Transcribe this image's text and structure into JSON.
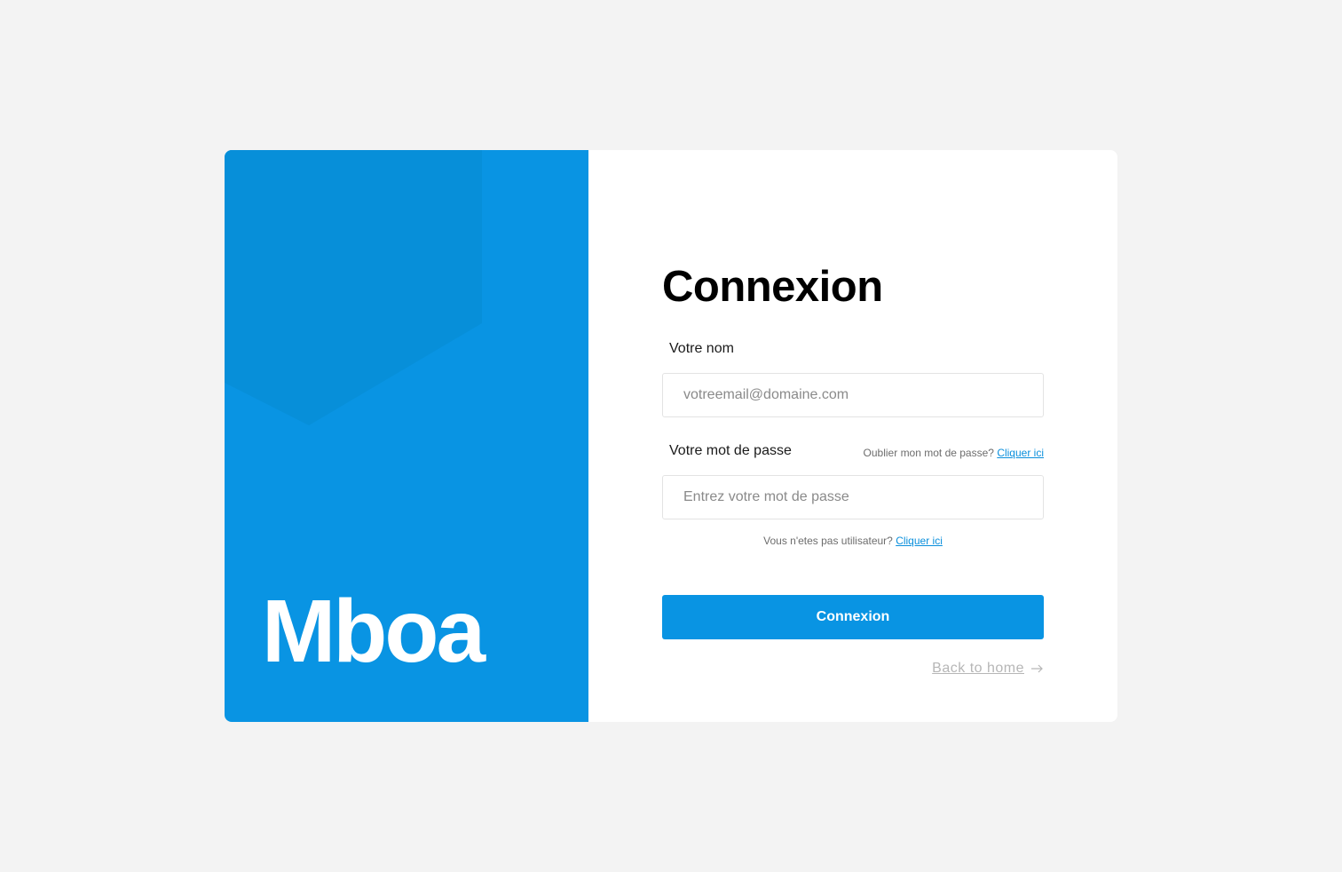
{
  "brand": {
    "name": "Mboa",
    "color": "#0994e3"
  },
  "login": {
    "title": "Connexion",
    "name_label": "Votre nom",
    "name_placeholder": "votreemail@domaine.com",
    "password_label": "Votre mot de passe",
    "password_placeholder": "Entrez votre mot de passe",
    "forgot_text": "Oublier mon mot de passe?",
    "forgot_link": "Cliquer ici",
    "signup_text": "Vous n'etes pas utilisateur?",
    "signup_link": "Cliquer ici",
    "submit_label": "Connexion",
    "back_home_label": "Back to home",
    "back_home_icon": "arrow-right-icon"
  }
}
